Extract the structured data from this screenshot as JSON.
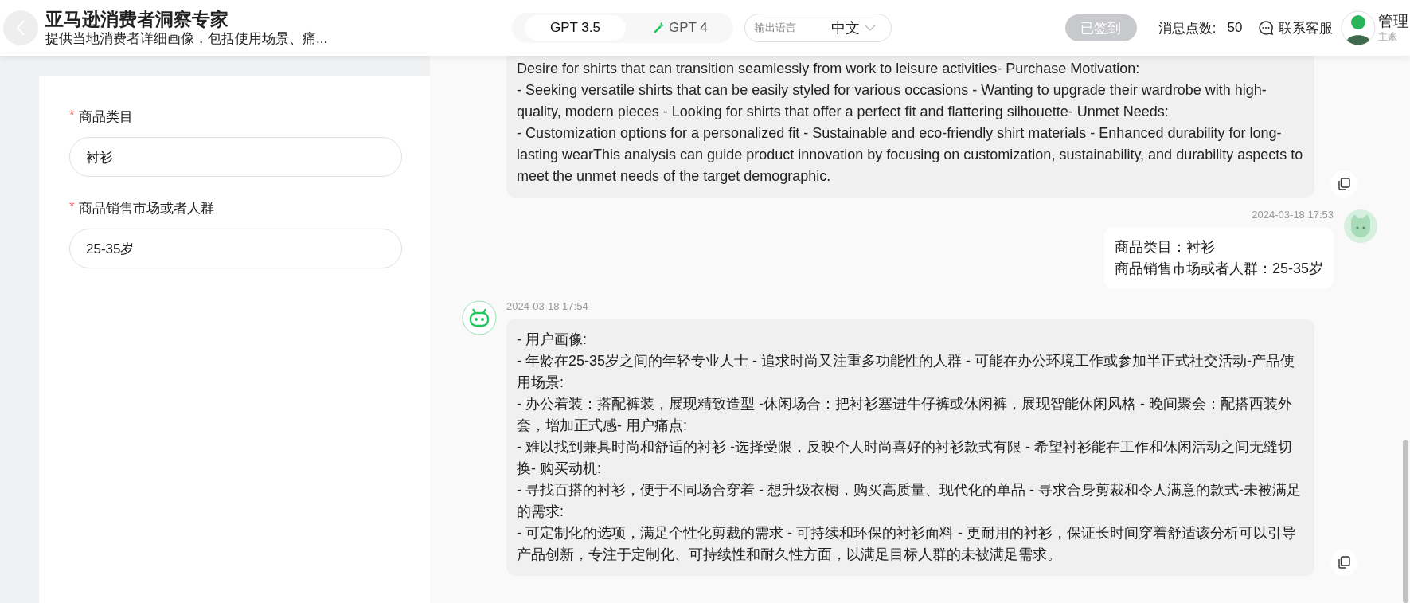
{
  "header": {
    "title": "亚马逊消费者洞察专家",
    "subtitle": "提供当地消费者详细画像，包括使用场景、痛...",
    "models": [
      {
        "label": "GPT 3.5",
        "selected": true,
        "kind": "plain"
      },
      {
        "label": "GPT 4",
        "selected": false,
        "kind": "magic"
      }
    ],
    "language": {
      "label": "输出语言",
      "value": "中文"
    },
    "checkin": {
      "label": "已签到",
      "disabled": true
    },
    "points": {
      "label": "消息点数:",
      "value": "50"
    },
    "support": "联系客服",
    "user": {
      "name": "管理",
      "role": "主账"
    }
  },
  "form": {
    "fields": [
      {
        "required_mark": "*",
        "label": "商品类目",
        "value": "衬衫"
      },
      {
        "required_mark": "*",
        "label": "商品销售市场或者人群",
        "value": "25-35岁"
      }
    ]
  },
  "messages": [
    {
      "kind": "bot",
      "text": "Desire for shirts that can transition seamlessly from work to leisure activities- Purchase Motivation:\n- Seeking versatile shirts that can be easily styled for various occasions - Wanting to upgrade their wardrobe with high-quality, modern pieces - Looking for shirts that offer a perfect fit and flattering silhouette- Unmet Needs:\n- Customization options for a personalized fit - Sustainable and eco-friendly shirt materials - Enhanced durability for long-lasting wearThis analysis can guide product innovation by focusing on customization, sustainability, and durability aspects to meet the unmet needs of the target demographic."
    },
    {
      "kind": "user",
      "timestamp": "2024-03-18 17:53",
      "lines": [
        "商品类目：衬衫",
        "商品销售市场或者人群：25-35岁"
      ]
    },
    {
      "kind": "bot",
      "timestamp": "2024-03-18 17:54",
      "text": "- 用户画像:\n- 年龄在25-35岁之间的年轻专业人士 - 追求时尚又注重多功能性的人群 - 可能在办公环境工作或参加半正式社交活动-产品使用场景:\n- 办公着装：搭配裤装，展现精致造型 -休闲场合：把衬衫塞进牛仔裤或休闲裤，展现智能休闲风格 - 晚间聚会：配搭西装外套，增加正式感- 用户痛点:\n- 难以找到兼具时尚和舒适的衬衫 -选择受限，反映个人时尚喜好的衬衫款式有限 - 希望衬衫能在工作和休闲活动之间无缝切换- 购买动机:\n- 寻找百搭的衬衫，便于不同场合穿着 - 想升级衣橱，购买高质量、现代化的单品 - 寻求合身剪裁和令人满意的款式-未被满足的需求:\n- 可定制化的选项，满足个性化剪裁的需求 - 可持续和环保的衬衫面料 - 更耐用的衬衫，保证长时间穿着舒适该分析可以引导产品创新，专注于定制化、可持续性和耐久性方面，以满足目标人群的未被满足需求。"
    }
  ]
}
